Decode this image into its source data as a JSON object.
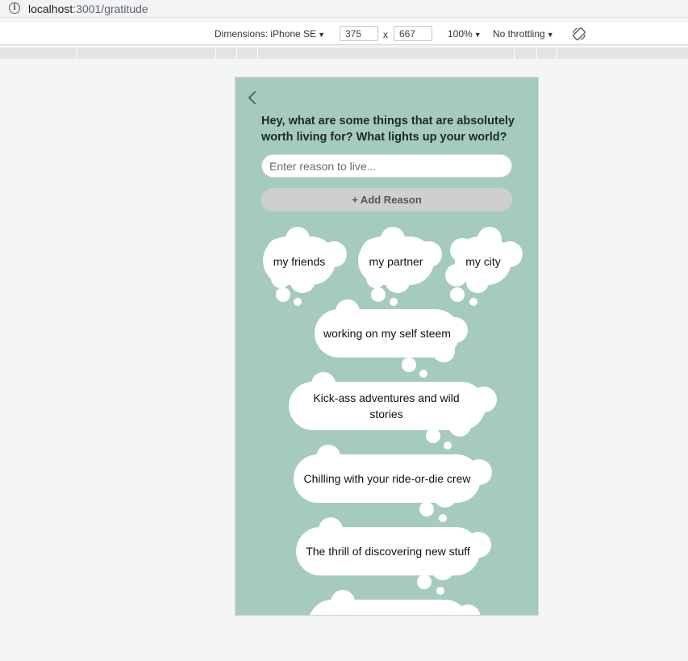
{
  "browser": {
    "url_host": "localhost",
    "url_path": ":3001/gratitude"
  },
  "devtools": {
    "dimensions_label": "Dimensions: iPhone SE",
    "width": "375",
    "times": "x",
    "height": "667",
    "zoom": "100%",
    "throttling": "No throttling"
  },
  "page": {
    "title": "Hey, what are some things that are absolutely worth living for? What lights up your world?",
    "input_placeholder": "Enter reason to live...",
    "add_button_label": "+ Add Reason",
    "reasons": [
      "my friends",
      "my partner",
      "my city",
      "working on my self steem",
      "Kick-ass adventures and wild stories",
      "Chilling with your ride-or-die crew",
      "The thrill of discovering new stuff",
      ""
    ]
  },
  "colors": {
    "page_background": "#a5cbbd",
    "bubble": "#ffffff",
    "button_disabled": "#cfcfcf"
  }
}
